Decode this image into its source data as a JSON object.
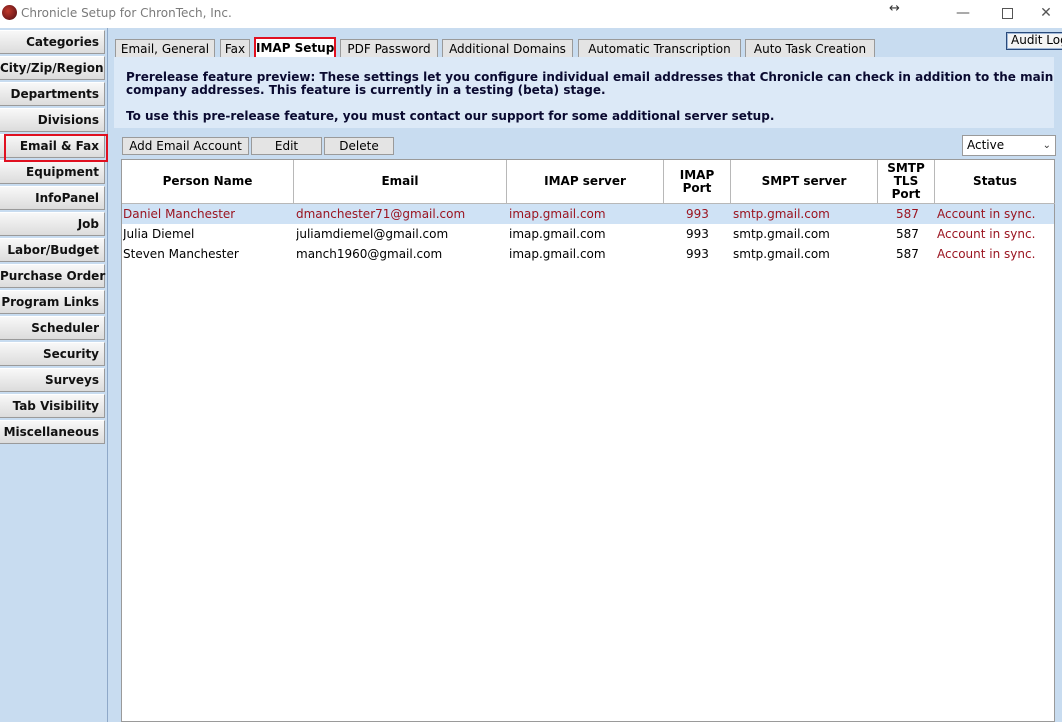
{
  "window": {
    "title": "Chronicle Setup for ChronTech, Inc.",
    "controls": {
      "resize": "↔",
      "minimize": "—",
      "close": "✕"
    }
  },
  "sidebar": {
    "items": [
      {
        "label": "Categories"
      },
      {
        "label": "City/Zip/Region"
      },
      {
        "label": "Departments"
      },
      {
        "label": "Divisions"
      },
      {
        "label": "Email & Fax",
        "selected": true
      },
      {
        "label": "Equipment"
      },
      {
        "label": "InfoPanel"
      },
      {
        "label": "Job"
      },
      {
        "label": "Labor/Budget"
      },
      {
        "label": "Purchase Order"
      },
      {
        "label": "Program Links"
      },
      {
        "label": "Scheduler"
      },
      {
        "label": "Security"
      },
      {
        "label": "Surveys"
      },
      {
        "label": "Tab Visibility"
      },
      {
        "label": "Miscellaneous"
      }
    ]
  },
  "toolbar": {
    "audit_label": "Audit Log"
  },
  "tabs": [
    {
      "label": "Email, General"
    },
    {
      "label": "Fax"
    },
    {
      "label": "IMAP Setup",
      "active": true
    },
    {
      "label": "PDF Password"
    },
    {
      "label": "Additional Domains"
    },
    {
      "label": "Automatic Transcription"
    },
    {
      "label": "Auto Task Creation"
    }
  ],
  "notice": {
    "line1": "Prerelease feature preview: These settings let you configure individual email addresses that Chronicle can check in addition to the main",
    "line2": "company addresses. This feature is currently in a testing (beta) stage.",
    "line3": "To use this pre-release feature, you must contact our support for some additional server setup."
  },
  "actions": {
    "add_label": "Add Email Account",
    "edit_label": "Edit",
    "delete_label": "Delete",
    "filter_value": "Active"
  },
  "table": {
    "headers": {
      "person": "Person Name",
      "email": "Email",
      "imap_server": "IMAP server",
      "imap_port_1": "IMAP",
      "imap_port_2": "Port",
      "smtp_server": "SMPT server",
      "smtp_port_1": "SMTP",
      "smtp_port_2": "TLS",
      "smtp_port_3": "Port",
      "status": "Status"
    },
    "rows": [
      {
        "person": "Daniel Manchester",
        "email": "dmanchester71@gmail.com",
        "imap_server": "imap.gmail.com",
        "imap_port": "993",
        "smtp_server": "smtp.gmail.com",
        "smtp_port": "587",
        "status": "Account in sync."
      },
      {
        "person": "Julia Diemel",
        "email": "juliamdiemel@gmail.com",
        "imap_server": "imap.gmail.com",
        "imap_port": "993",
        "smtp_server": "smtp.gmail.com",
        "smtp_port": "587",
        "status": "Account in sync."
      },
      {
        "person": "Steven Manchester",
        "email": "manch1960@gmail.com",
        "imap_server": "imap.gmail.com",
        "imap_port": "993",
        "smtp_server": "smtp.gmail.com",
        "smtp_port": "587",
        "status": "Account in sync."
      }
    ]
  },
  "colors": {
    "highlight_border": "#e01020",
    "panel_background": "#c8dcf0",
    "selected_row": "#cfe2f5",
    "status_text": "#9a1420"
  }
}
